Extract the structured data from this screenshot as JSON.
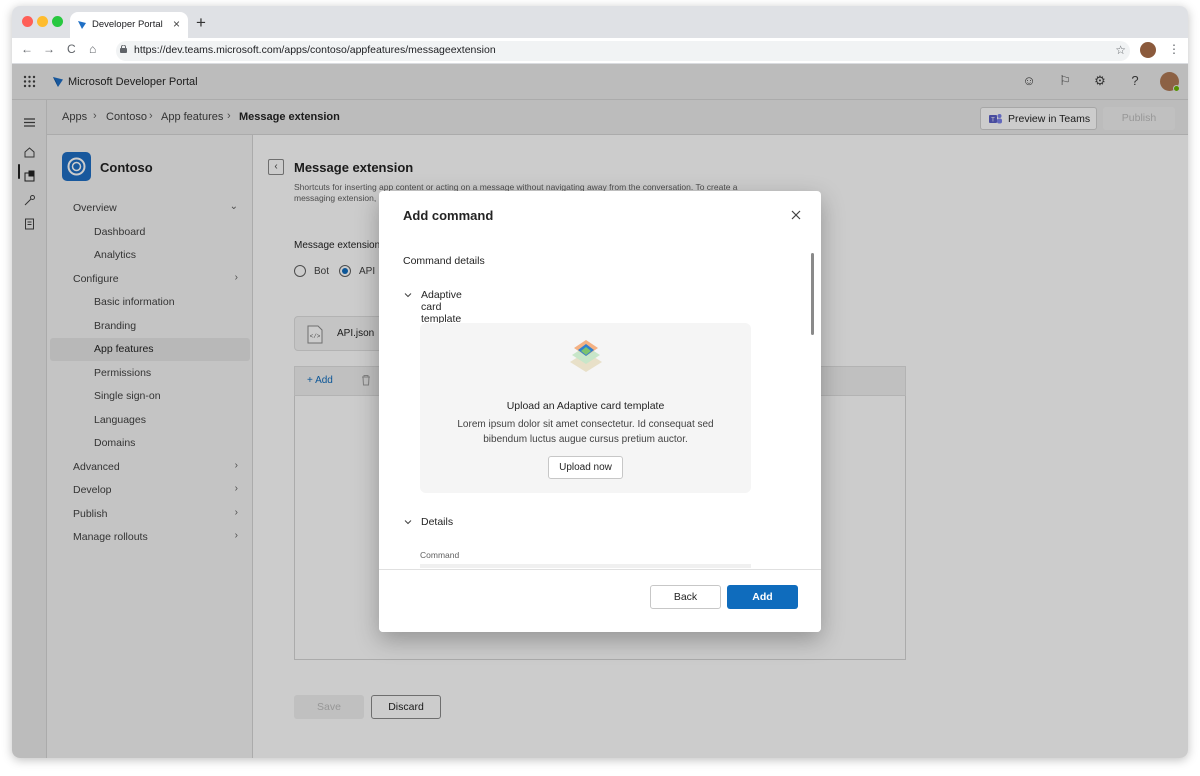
{
  "browser": {
    "tab_title": "Developer Portal",
    "tab_close": "×",
    "new_tab": "+",
    "url": "https://dev.teams.microsoft.com/apps/contoso/appfeatures/messageextension",
    "nav": {
      "back": "←",
      "forward": "→",
      "reload": "C",
      "home": "⌂"
    },
    "star": "☆",
    "menu": "⋮"
  },
  "app_header": {
    "title": "Microsoft Developer Portal",
    "icons": [
      "smiley-icon",
      "flag-icon",
      "gear-icon",
      "help-icon"
    ],
    "icon_glyphs": [
      "☺",
      "⚐",
      "⚙",
      "?"
    ]
  },
  "breadcrumb": {
    "items": [
      "Apps",
      "Contoso",
      "App features",
      "Message extension"
    ],
    "separator": "›"
  },
  "toolbar": {
    "preview_label": "Preview in Teams",
    "publish_label": "Publish"
  },
  "nav": {
    "app_name": "Contoso",
    "items": [
      {
        "label": "Overview",
        "chevron": "⌄",
        "level": 0
      },
      {
        "label": "Dashboard",
        "chevron": "",
        "level": 1
      },
      {
        "label": "Analytics",
        "chevron": "",
        "level": 1
      },
      {
        "label": "Configure",
        "chevron": "›",
        "level": 0
      },
      {
        "label": "Basic information",
        "chevron": "",
        "level": 1
      },
      {
        "label": "Branding",
        "chevron": "",
        "level": 1
      },
      {
        "label": "App features",
        "chevron": "",
        "level": 1,
        "selected": true
      },
      {
        "label": "Permissions",
        "chevron": "",
        "level": 1
      },
      {
        "label": "Single sign-on",
        "chevron": "",
        "level": 1
      },
      {
        "label": "Languages",
        "chevron": "",
        "level": 1
      },
      {
        "label": "Domains",
        "chevron": "",
        "level": 1
      },
      {
        "label": "Advanced",
        "chevron": "›",
        "level": 0
      },
      {
        "label": "Develop",
        "chevron": "›",
        "level": 0
      },
      {
        "label": "Publish",
        "chevron": "›",
        "level": 0
      },
      {
        "label": "Manage rollouts",
        "chevron": "›",
        "level": 0
      }
    ]
  },
  "main": {
    "back_glyph": "‹",
    "title": "Message extension",
    "description": "Shortcuts for inserting app content or acting on a message without navigating away from the conversation. To create a messaging extension,",
    "type_label": "Message extension",
    "radios": [
      {
        "label": "Bot",
        "checked": false
      },
      {
        "label": "API",
        "checked": true
      }
    ],
    "file_name": "API.json",
    "add_label": "+ Add",
    "save_label": "Save",
    "discard_label": "Discard"
  },
  "dialog": {
    "title": "Add command",
    "section_label": "Command details",
    "accordion_1": "Adaptive card template",
    "upload_title": "Upload an Adaptive card template",
    "upload_desc": "Lorem ipsum dolor sit amet consectetur. Id consequat sed bibendum luctus augue cursus pretium auctor.",
    "upload_button": "Upload now",
    "accordion_2": "Details",
    "field_label": "Command",
    "back_label": "Back",
    "add_label": "Add"
  },
  "colors": {
    "accent": "#0f6cbd",
    "brand_logo": "#1f6fc5",
    "presence": "#6bb700"
  }
}
